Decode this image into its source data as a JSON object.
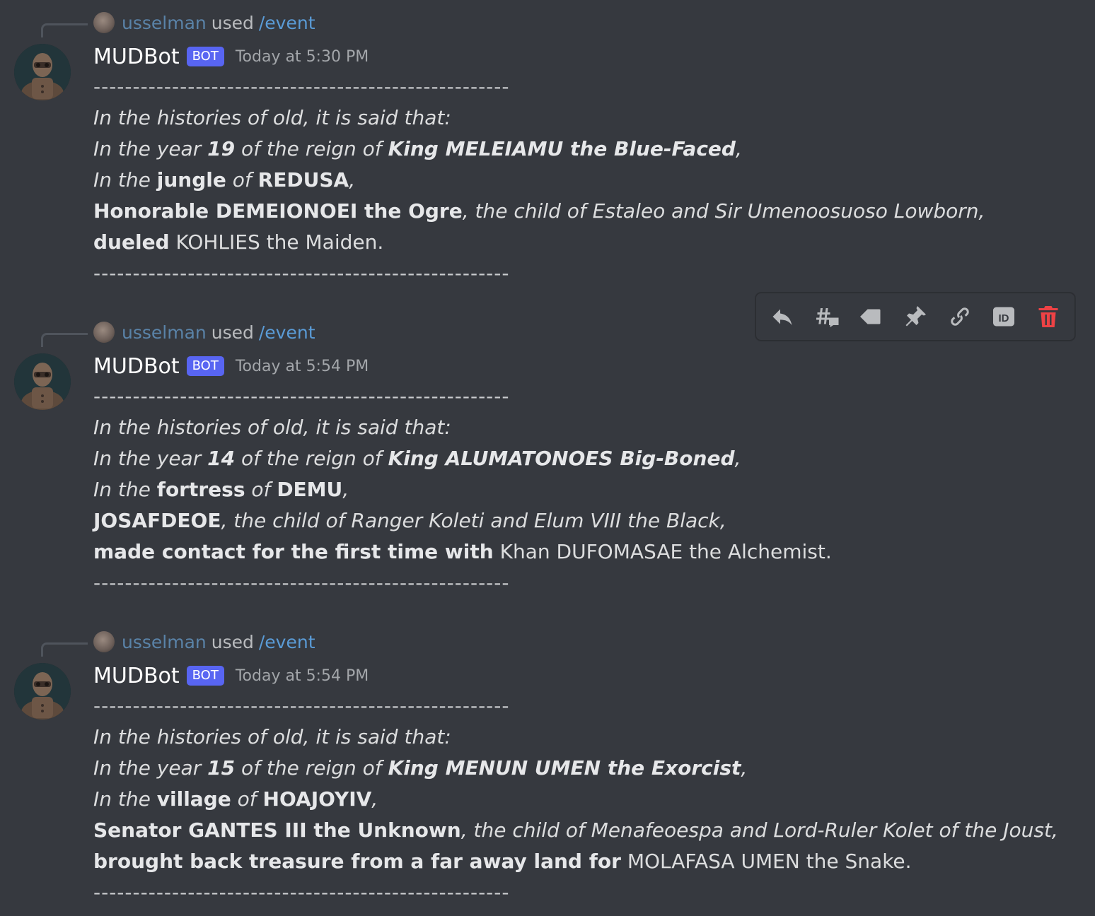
{
  "colors": {
    "background": "#36393f",
    "bot_badge": "#5865f2",
    "delete": "#ed4245",
    "icon": "#b9bbbe"
  },
  "messages": [
    {
      "reply_user": "usselman",
      "reply_used": "used",
      "reply_command": "/event",
      "author": "MUDBot",
      "badge": "BOT",
      "timestamp": "Today at 5:30 PM",
      "separator": "-----------------------------------------------------",
      "intro": "In the histories of old, it is said that:",
      "year_pre": "In the year ",
      "year": "19",
      "year_mid": " of the reign of ",
      "king": "King MELEIAMU the Blue-Faced",
      "year_end": ",",
      "place_pre": "In the ",
      "place_type": "jungle",
      "place_mid": " of ",
      "place": "REDUSA",
      "place_end": ",",
      "actor": "Honorable DEMEIONOEI the Ogre",
      "actor_rest": ", the child of Estaleo and Sir Umenoosuoso Lowborn,",
      "action": "dueled",
      "target": " KOHLIES the Maiden."
    },
    {
      "reply_user": "usselman",
      "reply_used": "used",
      "reply_command": "/event",
      "author": "MUDBot",
      "badge": "BOT",
      "timestamp": "Today at 5:54 PM",
      "separator": "-----------------------------------------------------",
      "intro": "In the histories of old, it is said that:",
      "year_pre": "In the year ",
      "year": "14",
      "year_mid": " of the reign of ",
      "king": "King ALUMATONOES Big-Boned",
      "year_end": ",",
      "place_pre": "In the ",
      "place_type": "fortress",
      "place_mid": " of ",
      "place": "DEMU",
      "place_end": ",",
      "actor": "JOSAFDEOE",
      "actor_rest": ", the child of Ranger Koleti and Elum VIII the Black,",
      "action": "made contact for the first time with",
      "target": " Khan DUFOMASAE the Alchemist."
    },
    {
      "reply_user": "usselman",
      "reply_used": "used",
      "reply_command": "/event",
      "author": "MUDBot",
      "badge": "BOT",
      "timestamp": "Today at 5:54 PM",
      "separator": "-----------------------------------------------------",
      "intro": "In the histories of old, it is said that:",
      "year_pre": "In the year ",
      "year": "15",
      "year_mid": " of the reign of ",
      "king": "King MENUN UMEN the Exorcist",
      "year_end": ",",
      "place_pre": "In the ",
      "place_type": "village",
      "place_mid": " of ",
      "place": "HOAJOYIV",
      "place_end": ",",
      "actor": "Senator GANTES III the Unknown",
      "actor_rest": ", the child of Menafeoespa and Lord-Ruler Kolet of the Joust,",
      "action": "brought back treasure from a far away land for",
      "target": " MOLAFASA UMEN the Snake."
    }
  ],
  "toolbar": {
    "icons": [
      "reply-icon",
      "thread-icon",
      "tag-icon",
      "pin-icon",
      "link-icon",
      "id-icon",
      "trash-icon"
    ]
  }
}
